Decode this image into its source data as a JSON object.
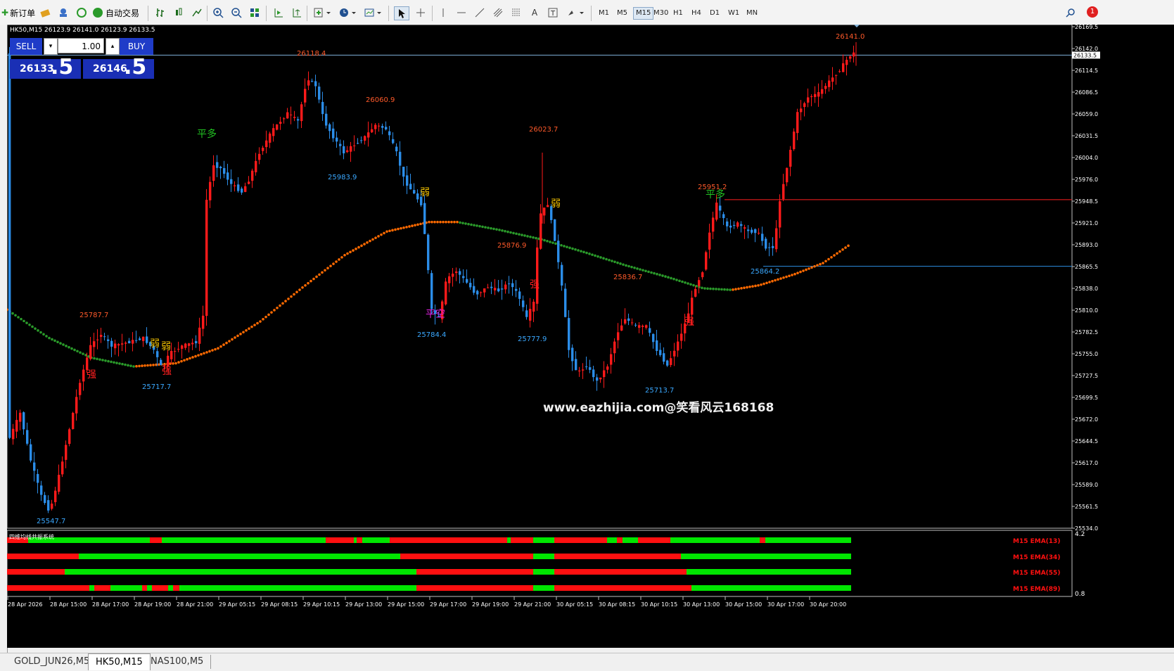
{
  "toolbar": {
    "new_order": "新订单",
    "auto_trading": "自动交易",
    "timeframes": [
      "M1",
      "M5",
      "M15",
      "M30",
      "H1",
      "H4",
      "D1",
      "W1",
      "MN"
    ],
    "active_timeframe": "M15",
    "notification_count": "1"
  },
  "chart": {
    "header": "HK50,M15  26123.9 26141.0 26123.9 26133.5",
    "watermark": "www.eazhijia.com@笑看风云168168",
    "current_price_label": "26133.5",
    "indicator_title": "四维均线共振系统",
    "indicator_max": "4.2",
    "indicator_min": "0.8"
  },
  "trade_panel": {
    "sell_label": "SELL",
    "buy_label": "BUY",
    "volume": "1.00",
    "sell_price_main": "26133",
    "sell_price_frac": ".5",
    "buy_price_main": "26146",
    "buy_price_frac": ".5"
  },
  "price_axis": [
    "26169.5",
    "26142.0",
    "26114.5",
    "26086.5",
    "26059.0",
    "26031.5",
    "26004.0",
    "25976.0",
    "25948.5",
    "25921.0",
    "25893.0",
    "25865.5",
    "25838.0",
    "25810.0",
    "25782.5",
    "25755.0",
    "25727.5",
    "25699.5",
    "25672.0",
    "25644.5",
    "25617.0",
    "25589.0",
    "25561.5",
    "25534.0"
  ],
  "time_axis": [
    "28 Apr 2026",
    "28 Apr 15:00",
    "28 Apr 17:00",
    "28 Apr 19:00",
    "28 Apr 21:00",
    "29 Apr 05:15",
    "29 Apr 08:15",
    "29 Apr 10:15",
    "29 Apr 13:00",
    "29 Apr 15:00",
    "29 Apr 17:00",
    "29 Apr 19:00",
    "29 Apr 21:00",
    "30 Apr 05:15",
    "30 Apr 08:15",
    "30 Apr 10:15",
    "30 Apr 13:00",
    "30 Apr 15:00",
    "30 Apr 17:00",
    "30 Apr 20:00"
  ],
  "annotations": [
    {
      "text": "26118.4",
      "type": "high"
    },
    {
      "text": "26060.9",
      "type": "high"
    },
    {
      "text": "26023.7",
      "type": "high"
    },
    {
      "text": "26141.0",
      "type": "high"
    },
    {
      "text": "25951.2",
      "type": "high"
    },
    {
      "text": "25787.7",
      "type": "high"
    },
    {
      "text": "25876.9",
      "type": "high"
    },
    {
      "text": "25836.7",
      "type": "high"
    },
    {
      "text": "25983.9",
      "type": "low"
    },
    {
      "text": "25717.7",
      "type": "low"
    },
    {
      "text": "25784.4",
      "type": "low"
    },
    {
      "text": "25777.9",
      "type": "low"
    },
    {
      "text": "25713.7",
      "type": "low"
    },
    {
      "text": "25864.2",
      "type": "low"
    },
    {
      "text": "25547.7",
      "type": "low"
    }
  ],
  "signals": [
    {
      "text": "平多",
      "color": "#22c322"
    },
    {
      "text": "弱",
      "color": "#f5c400"
    },
    {
      "text": "强",
      "color": "#ff2020"
    },
    {
      "text": "弱",
      "color": "#f5c400"
    },
    {
      "text": "强",
      "color": "#ff2020"
    },
    {
      "text": "弱",
      "color": "#f5c400"
    },
    {
      "text": "平空",
      "color": "#e020e0"
    },
    {
      "text": "弱",
      "color": "#f5c400"
    },
    {
      "text": "强",
      "color": "#ff2020"
    },
    {
      "text": "强",
      "color": "#ff2020"
    },
    {
      "text": "平多",
      "color": "#22c322"
    }
  ],
  "indicator_rows": [
    {
      "label": "M15 EMA(13)"
    },
    {
      "label": "M15 EMA(34)"
    },
    {
      "label": "M15 EMA(55)"
    },
    {
      "label": "M15 EMA(89)"
    }
  ],
  "bottom_tabs": [
    "GOLD_JUN26,M5",
    "HK50,M15",
    "NAS100,M5"
  ],
  "active_tab": "HK50,M15",
  "colors": {
    "bull": "#ff1a1a",
    "bear": "#2b8de8",
    "ema_up": "#ff6a00",
    "ema_down": "#2a9a2a",
    "ask_line": "#7fb0d8",
    "red_line": "#ff2020",
    "blue_line": "#2a88d8"
  }
}
